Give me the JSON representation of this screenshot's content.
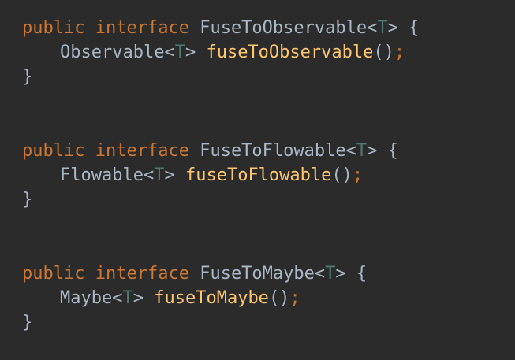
{
  "editor": {
    "colors": {
      "background": "#2b2b2b",
      "keyword": "#cc7832",
      "identifier": "#a9b7c6",
      "type_param": "#507874",
      "method": "#ffc66d"
    },
    "blocks": [
      {
        "kw_public": "public",
        "kw_interface": "interface",
        "interface_name": "FuseToObservable",
        "lt": "<",
        "type_param": "T",
        "gt": ">",
        "open_brace": "{",
        "return_type": "Observable",
        "ret_lt": "<",
        "ret_type_param": "T",
        "ret_gt": ">",
        "method_name": "fuseToObservable",
        "parens": "()",
        "semicolon": ";",
        "close_brace": "}"
      },
      {
        "kw_public": "public",
        "kw_interface": "interface",
        "interface_name": "FuseToFlowable",
        "lt": "<",
        "type_param": "T",
        "gt": ">",
        "open_brace": "{",
        "return_type": "Flowable",
        "ret_lt": "<",
        "ret_type_param": "T",
        "ret_gt": ">",
        "method_name": "fuseToFlowable",
        "parens": "()",
        "semicolon": ";",
        "close_brace": "}"
      },
      {
        "kw_public": "public",
        "kw_interface": "interface",
        "interface_name": "FuseToMaybe",
        "lt": "<",
        "type_param": "T",
        "gt": ">",
        "open_brace": "{",
        "return_type": "Maybe",
        "ret_lt": "<",
        "ret_type_param": "T",
        "ret_gt": ">",
        "method_name": "fuseToMaybe",
        "parens": "()",
        "semicolon": ";",
        "close_brace": "}"
      }
    ]
  }
}
